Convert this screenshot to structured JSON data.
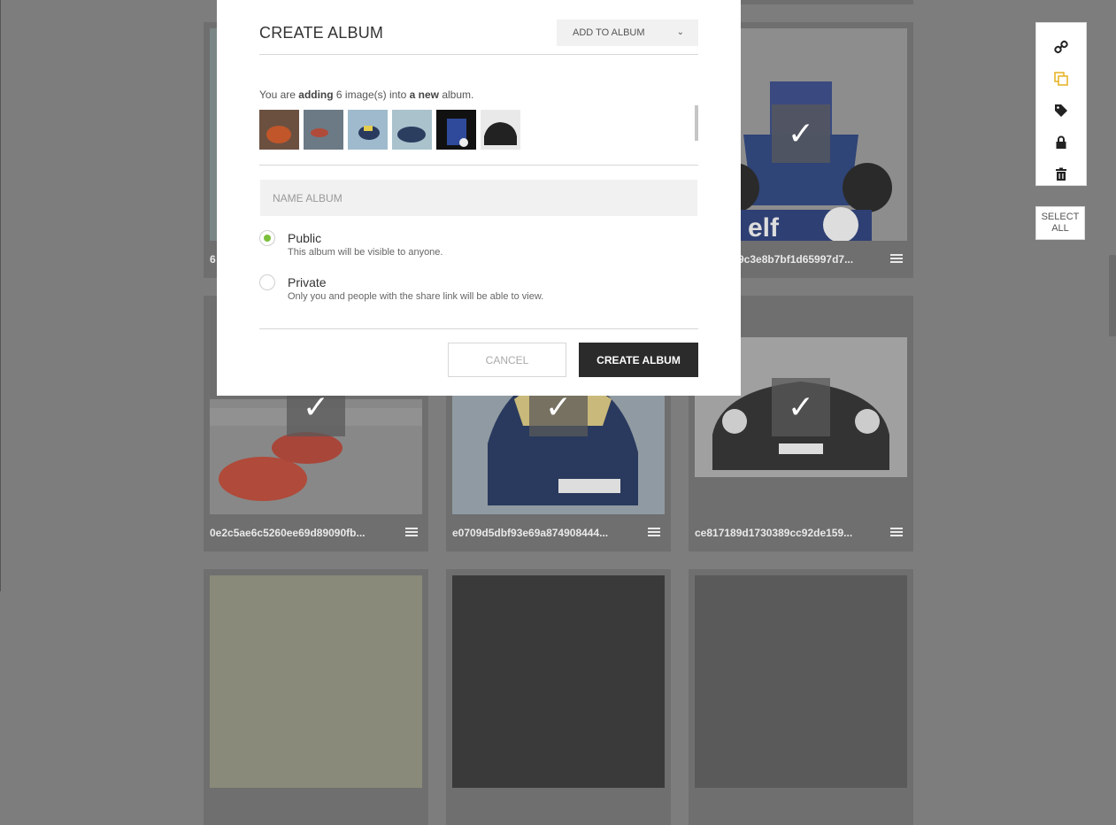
{
  "modal": {
    "title": "CREATE ALBUM",
    "add_to_album_label": "ADD TO ALBUM",
    "info": {
      "prefix": "You are ",
      "adding": "adding",
      "count_text": " 6 image(s) into ",
      "a_new": "a new",
      "suffix": " album."
    },
    "name_placeholder": "NAME ALBUM",
    "options": [
      {
        "title": "Public",
        "description": "This album will be visible to anyone.",
        "selected": true
      },
      {
        "title": "Private",
        "description": "Only you and people with the share link will be able to view.",
        "selected": false
      }
    ],
    "cancel_label": "CANCEL",
    "create_label": "CREATE ALBUM"
  },
  "toolbar": {
    "tools": [
      "link-icon",
      "copy-icon",
      "tag-icon",
      "lock-icon",
      "trash-icon"
    ],
    "active_color": "#e6b01f",
    "select_all_label": "SELECT ALL"
  },
  "grid": {
    "captions": {
      "c1": "6",
      "c3": "9c3e8b7bf1d65997d7...",
      "c4": "0e2c5ae6c5260ee69d89090fb...",
      "c5": "e0709d5dbf93e69a874908444...",
      "c6": "ce817189d1730389cc92de159..."
    }
  },
  "colors": {
    "overlay": "#7d7d7d",
    "primary_button": "#2b2b2b",
    "radio_selected": "#7bbf3a"
  }
}
